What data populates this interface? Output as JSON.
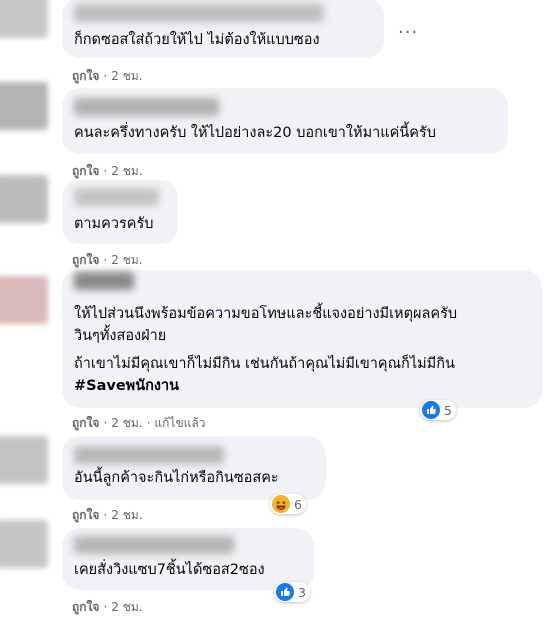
{
  "comments": [
    {
      "text_lines": [
        "ก็กดซอสใส่ถ้วยให้ไป ไม่ต้องให้แบบซอง"
      ],
      "like": "ถูกใจ",
      "time": "2 ชม."
    },
    {
      "text_lines": [
        "คนละครึ่งทางครับ ให้ไปอย่างละ20 บอกเขาให้มาแค่นี้ครับ"
      ],
      "like": "ถูกใจ",
      "time": "2 ชม."
    },
    {
      "text_lines": [
        "ตามควรครับ"
      ],
      "like": "ถูกใจ",
      "time": "2 ชม."
    },
    {
      "text_lines": [
        "ให้ไปส่วนนึงพร้อมข้อความขอโทษและชี้แจงอย่างมีเหตุผลครับ",
        "วินๆทั้งสองฝ่าย",
        "ถ้าเขาไม่มีคุณเขาก็ไม่มีกิน เช่นกันถ้าคุณไม่มีเขาคุณก็ไม่มีกิน"
      ],
      "hashtag": "#Saveพนักงาน",
      "like": "ถูกใจ",
      "time": "2 ชม.",
      "edited": "แก้ไขแล้ว",
      "reaction_count": "5",
      "reaction_icons": [
        "like-icon"
      ]
    },
    {
      "text_lines": [
        "อันนี้ลูกค้าจะกินไก่หรือกินซอสคะ"
      ],
      "like": "ถูกใจ",
      "time": "2 ชม.",
      "reaction_count": "6",
      "reaction_icons": [
        "haha-icon"
      ]
    },
    {
      "text_lines": [
        "เคยสั่งวิงแซบ7ชิ้นได้ซอส2ซอง"
      ],
      "like": "ถูกใจ",
      "time": "2 ชม.",
      "reaction_count": "3",
      "reaction_icons": [
        "like-icon"
      ]
    }
  ],
  "separator": "·",
  "more_menu": "···",
  "colors": {
    "bubble": "#f0f2f5",
    "meta": "#65676b",
    "like_blue": "#1877f2",
    "haha_yellow": "#f7b125"
  }
}
